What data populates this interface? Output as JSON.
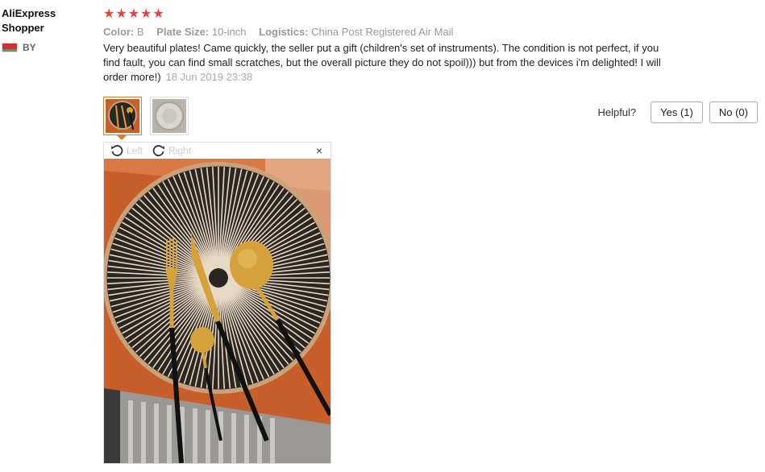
{
  "user": {
    "name": "AliExpress\nShopper",
    "country": "BY"
  },
  "review": {
    "stars": "★★★★★",
    "attrs": [
      {
        "key": "Color:",
        "value": "B"
      },
      {
        "key": "Plate Size:",
        "value": "10-inch"
      },
      {
        "key": "Logistics:",
        "value": "China Post Registered Air Mail"
      }
    ],
    "text": "Very beautiful plates! Came quickly, the seller put a gift (children's set of instruments). The condition is not perfect, if you find fault, you can find small scratches, but the overall picture they do not spoil))) but from the devices i'm delighted! I will order more!)",
    "date": "18 Jun 2019 23:38"
  },
  "helpful": {
    "label": "Helpful?",
    "yes": "Yes (1)",
    "no": "No (0)"
  },
  "viewer": {
    "rotate_left": "Left",
    "rotate_right": "Right",
    "close": "×"
  },
  "colors": {
    "star": "#e6443c",
    "active_thumb": "#e07a2b",
    "plate_rim": "#c9a27a",
    "plate_body": "#2b2622",
    "table_wood": "#c85f2a",
    "gold": "#d4a13a"
  }
}
